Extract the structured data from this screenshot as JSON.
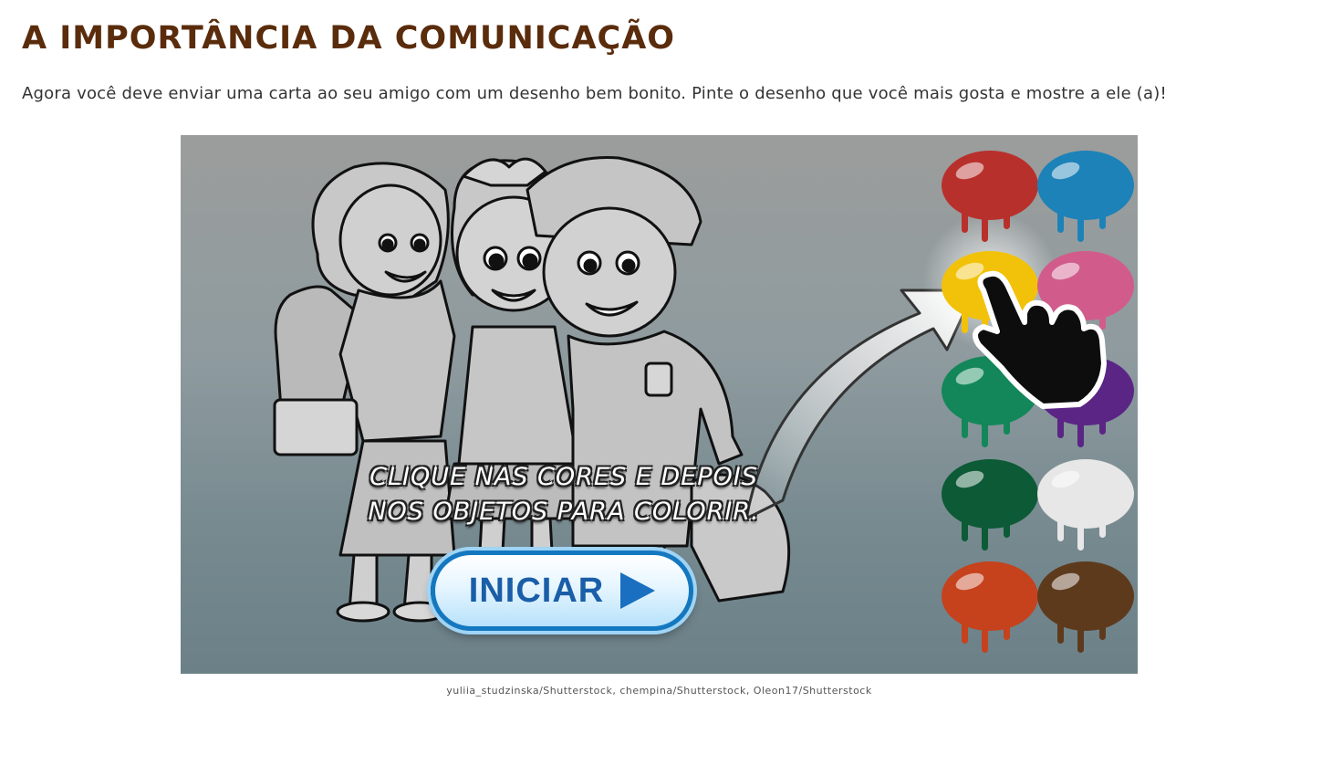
{
  "page": {
    "title": "A IMPORTÂNCIA DA COMUNICAÇÃO",
    "intro": "Agora você deve enviar uma carta ao seu amigo com um desenho bem bonito. Pinte o desenho que você mais gosta e mostre a ele (a)!"
  },
  "activity": {
    "instruction_line1": "CLIQUE NAS CORES E DEPOIS",
    "instruction_line2": "NOS OBJETOS PARA COLORIR.",
    "start_button_label": "INICIAR",
    "start_button_icon": "play-arrow-icon",
    "pointer_icon": "hand-pointer-icon",
    "palette": [
      {
        "name": "red",
        "color": "#b8302c"
      },
      {
        "name": "blue",
        "color": "#1d82b8"
      },
      {
        "name": "yellow",
        "color": "#f2c20a"
      },
      {
        "name": "pink",
        "color": "#d15c8c"
      },
      {
        "name": "green",
        "color": "#13875a"
      },
      {
        "name": "purple",
        "color": "#5a2585"
      },
      {
        "name": "dark-green",
        "color": "#0c5a36"
      },
      {
        "name": "white",
        "color": "#e7e7e7"
      },
      {
        "name": "orange",
        "color": "#c5421d"
      },
      {
        "name": "brown",
        "color": "#5e3a1d"
      }
    ]
  },
  "credit": "yuliia_studzinska/Shutterstock, chempina/Shutterstock, Oleon17/Shutterstock"
}
